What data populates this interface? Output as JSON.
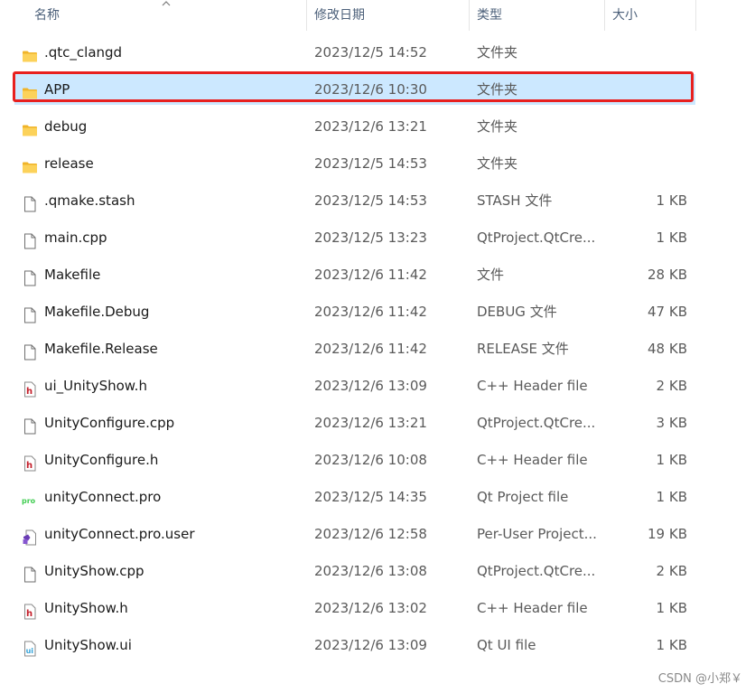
{
  "columns": {
    "name": "名称",
    "date": "修改日期",
    "type": "类型",
    "size": "大小"
  },
  "files": [
    {
      "icon": "folder-icon",
      "name": ".qtc_clangd",
      "date": "2023/12/5 14:52",
      "type": "文件夹",
      "size": ""
    },
    {
      "icon": "folder-icon",
      "name": "APP",
      "date": "2023/12/6 10:30",
      "type": "文件夹",
      "size": "",
      "selected": true
    },
    {
      "icon": "folder-icon",
      "name": "debug",
      "date": "2023/12/6 13:21",
      "type": "文件夹",
      "size": ""
    },
    {
      "icon": "folder-icon",
      "name": "release",
      "date": "2023/12/5 14:53",
      "type": "文件夹",
      "size": ""
    },
    {
      "icon": "blank-file-icon",
      "name": ".qmake.stash",
      "date": "2023/12/5 14:53",
      "type": "STASH 文件",
      "size": "1 KB"
    },
    {
      "icon": "blank-file-icon",
      "name": "main.cpp",
      "date": "2023/12/5 13:23",
      "type": "QtProject.QtCre...",
      "size": "1 KB"
    },
    {
      "icon": "blank-file-icon",
      "name": "Makefile",
      "date": "2023/12/6 11:42",
      "type": "文件",
      "size": "28 KB"
    },
    {
      "icon": "blank-file-icon",
      "name": "Makefile.Debug",
      "date": "2023/12/6 11:42",
      "type": "DEBUG 文件",
      "size": "47 KB"
    },
    {
      "icon": "blank-file-icon",
      "name": "Makefile.Release",
      "date": "2023/12/6 11:42",
      "type": "RELEASE 文件",
      "size": "48 KB"
    },
    {
      "icon": "header-file-icon",
      "name": "ui_UnityShow.h",
      "date": "2023/12/6 13:09",
      "type": "C++ Header file",
      "size": "2 KB"
    },
    {
      "icon": "blank-file-icon",
      "name": "UnityConfigure.cpp",
      "date": "2023/12/6 13:21",
      "type": "QtProject.QtCre...",
      "size": "3 KB"
    },
    {
      "icon": "header-file-icon",
      "name": "UnityConfigure.h",
      "date": "2023/12/6 10:08",
      "type": "C++ Header file",
      "size": "1 KB"
    },
    {
      "icon": "pro-file-icon",
      "name": "unityConnect.pro",
      "date": "2023/12/5 14:35",
      "type": "Qt Project file",
      "size": "1 KB"
    },
    {
      "icon": "pro-user-file-icon",
      "name": "unityConnect.pro.user",
      "date": "2023/12/6 12:58",
      "type": "Per-User Project...",
      "size": "19 KB"
    },
    {
      "icon": "blank-file-icon",
      "name": "UnityShow.cpp",
      "date": "2023/12/6 13:08",
      "type": "QtProject.QtCre...",
      "size": "2 KB"
    },
    {
      "icon": "header-file-icon",
      "name": "UnityShow.h",
      "date": "2023/12/6 13:02",
      "type": "C++ Header file",
      "size": "1 KB"
    },
    {
      "icon": "ui-file-icon",
      "name": "UnityShow.ui",
      "date": "2023/12/6 13:09",
      "type": "Qt UI file",
      "size": "1 KB"
    }
  ],
  "watermark": "CSDN @小郑￥",
  "colors": {
    "selection_bg": "#cce8ff",
    "highlight_border": "#e8201f",
    "folder": "#f8c53a",
    "header_icon": "#c41e2a",
    "pro_icon": "#41cd52",
    "ui_icon": "#35a3d9"
  }
}
